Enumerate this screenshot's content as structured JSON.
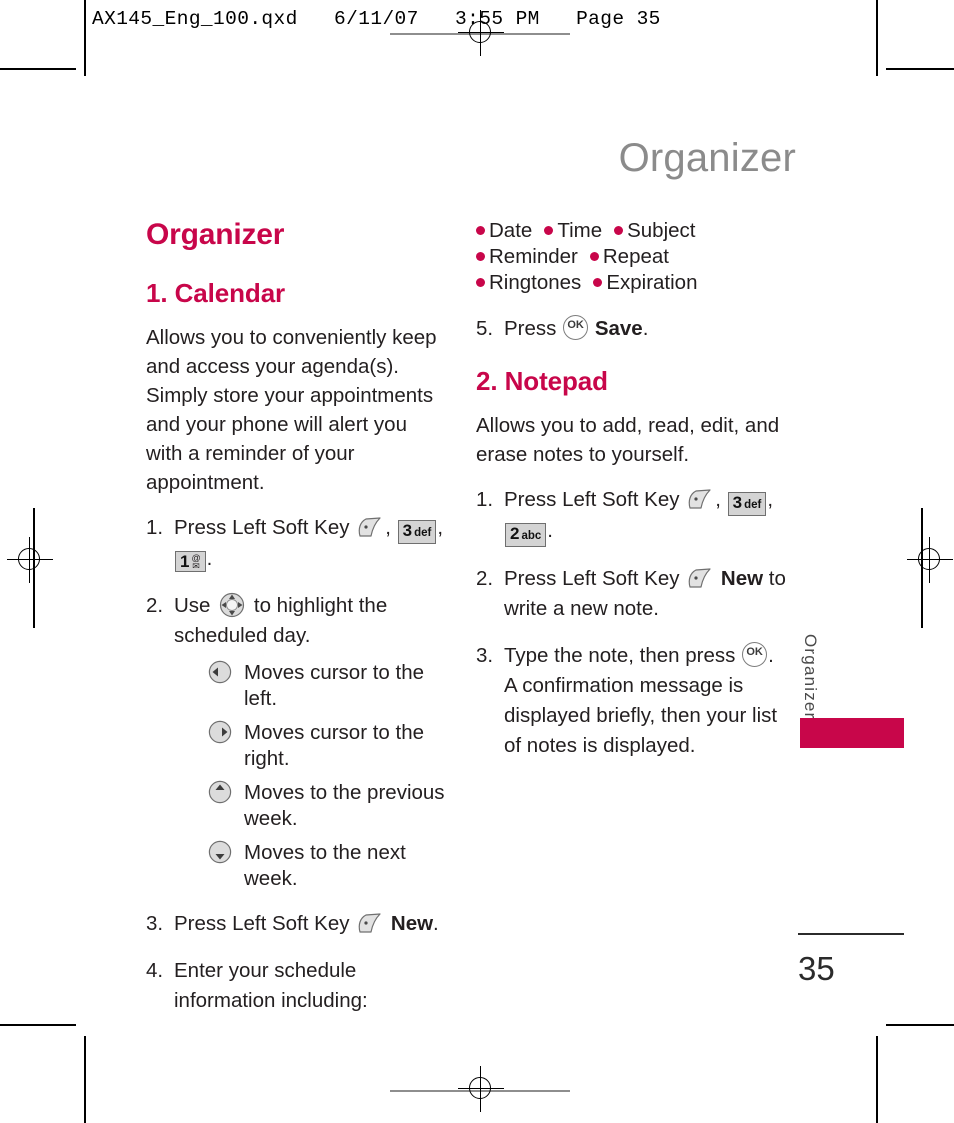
{
  "prepress": {
    "file_header": "AX145_Eng_100.qxd   6/11/07   3:55 PM   Page 35"
  },
  "running_head": "Organizer",
  "side_tab": {
    "label": "Organizer",
    "bar_color": "#c8064a"
  },
  "folio": {
    "page_number": "35"
  },
  "colors": {
    "accent": "#c8064a",
    "running_head": "#8b8b8b",
    "body_text": "#231f20",
    "keycap_fill": "#d4d4d4",
    "keycap_border": "#6f6f6f"
  },
  "left_column": {
    "section_title": "Organizer",
    "subsection_title": "1. Calendar",
    "intro": "Allows you to conveniently keep and access your agenda(s). Simply store your appointments and your phone will alert you with a reminder of your appointment.",
    "steps": [
      {
        "num": "1.",
        "lead": "Press Left Soft Key",
        "keys": [
          "3 def",
          "1 @"
        ],
        "trailing": "."
      },
      {
        "num": "2.",
        "lead": "Use",
        "after": "to highlight the scheduled day.",
        "directions": [
          {
            "icon": "nav-left-icon",
            "text": "Moves cursor to the left."
          },
          {
            "icon": "nav-right-icon",
            "text": "Moves cursor to the right."
          },
          {
            "icon": "nav-up-icon",
            "text": "Moves to the previous week."
          },
          {
            "icon": "nav-down-icon",
            "text": "Moves to the next week."
          }
        ]
      },
      {
        "num": "3.",
        "lead": "Press Left Soft Key",
        "bold_word": "New",
        "trailing": "."
      },
      {
        "num": "4.",
        "lead": "Enter your schedule information including:"
      }
    ]
  },
  "right_column": {
    "feature_bullets": [
      "Date",
      "Time",
      "Subject",
      "Reminder",
      "Repeat",
      "Ringtones",
      "Expiration"
    ],
    "save_step": {
      "num": "5.",
      "lead": "Press",
      "bold_word": "Save",
      "trailing": "."
    },
    "subsection_title": "2. Notepad",
    "intro": "Allows you to add, read, edit, and erase notes to yourself.",
    "steps": [
      {
        "num": "1.",
        "lead": "Press Left Soft Key",
        "keys": [
          "3 def",
          "2 abc"
        ],
        "trailing": "."
      },
      {
        "num": "2.",
        "lead": "Press Left Soft Key",
        "bold_word": "New",
        "after": "to write a new note."
      },
      {
        "num": "3.",
        "lead": "Type the note, then press",
        "trailing": ".",
        "after": "A confirmation message is displayed briefly, then your list of notes is displayed."
      }
    ]
  },
  "keycaps": {
    "three_def": {
      "big": "3",
      "small": "def"
    },
    "two_abc": {
      "big": "2",
      "small": "abc"
    },
    "one_at": {
      "big": "1",
      "small": "@"
    }
  }
}
